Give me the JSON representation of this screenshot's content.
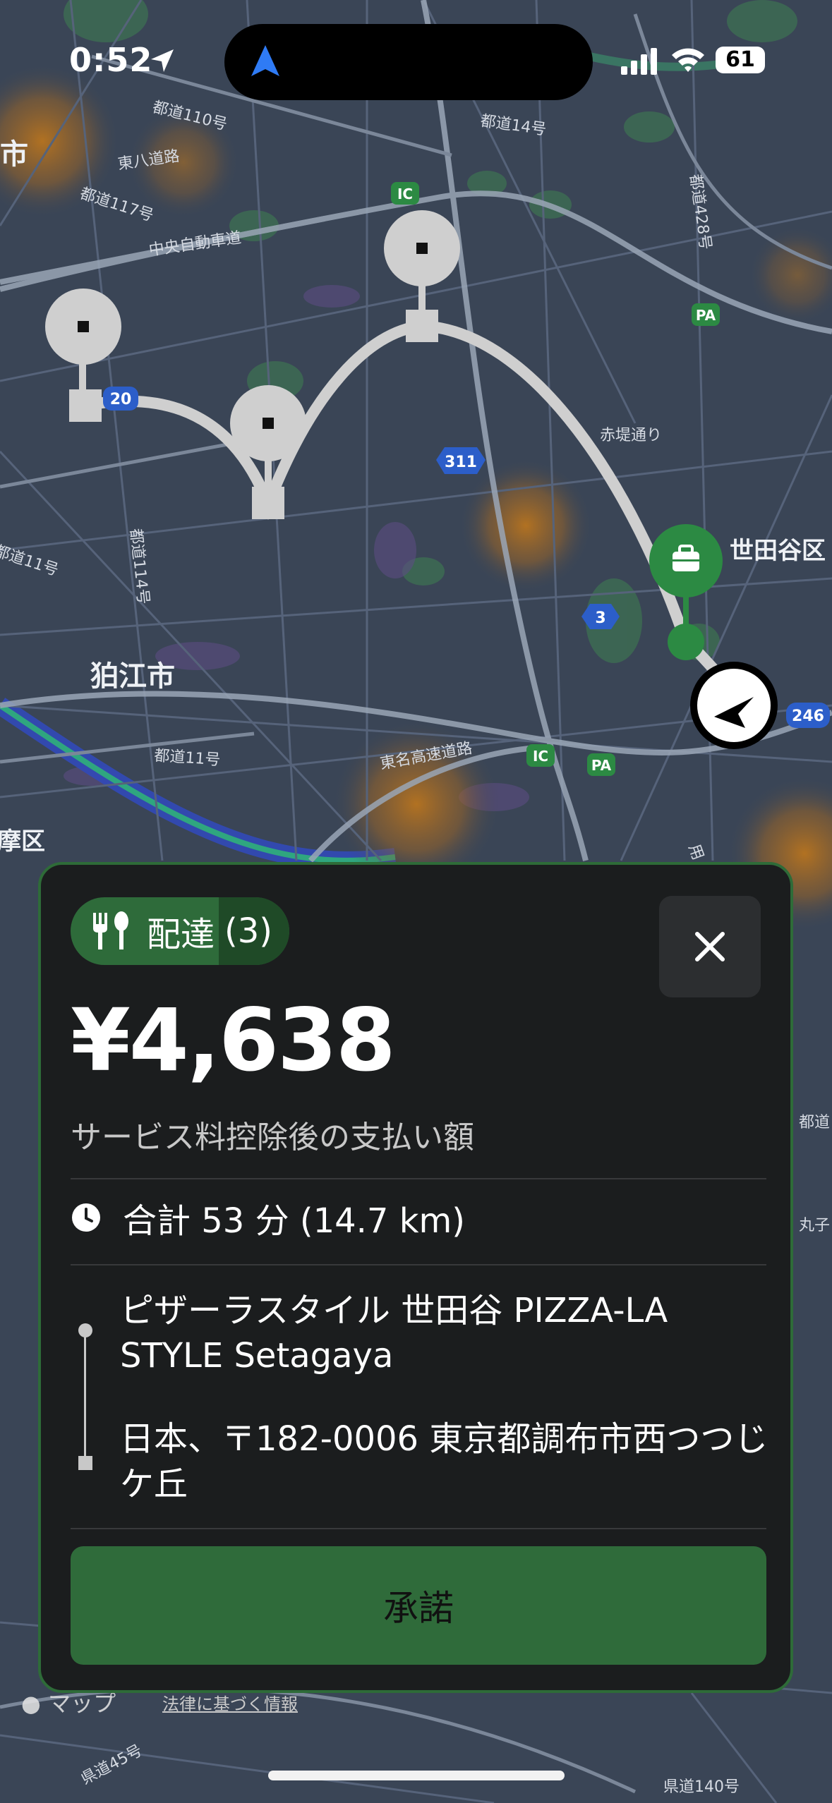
{
  "status_bar": {
    "time": "0:52",
    "battery": "61"
  },
  "map": {
    "labels": {
      "city_left": "市",
      "route110": "都道110号",
      "route14": "都道14号",
      "higashi_hachi": "東八道路",
      "route117": "都道117号",
      "chuo_expressway": "中央自動車道",
      "route428": "都道428号",
      "akatsutsumi": "赤堤通り",
      "setagaya": "世田谷区",
      "komae": "狛江市",
      "route114": "都道114号",
      "route11_left": "都道11号",
      "route11": "都道11号",
      "tomei": "東名高速道路",
      "ward_left": "摩区",
      "route45": "県道45号",
      "route140": "県道140号",
      "pref_road": "都道",
      "toyo": "用",
      "marko": "丸子"
    },
    "shields": {
      "ic1": "IC",
      "ic2": "IC",
      "pa1": "PA",
      "pa2": "PA",
      "r20": "20",
      "r311": "311",
      "r3": "3",
      "r246": "246"
    },
    "attribution": "マップ",
    "legal": "法律に基づく情報"
  },
  "card": {
    "badge_label": "配達",
    "badge_count": "(3)",
    "price": "¥4,638",
    "price_subtitle": "サービス料控除後の支払い額",
    "trip_summary": "合計 53 分 (14.7 km)",
    "pickup_name": "ピザーラスタイル 世田谷 PIZZA-LA STYLE Setagaya",
    "dropoff_address": "日本、〒182-0006 東京都調布市西つつじケ丘",
    "accept_label": "承諾"
  },
  "colors": {
    "map_bg": "#3a4556",
    "card_bg": "#1b1d1e",
    "accent_green": "#2f6b3a",
    "route_gray": "#c8c8c8"
  }
}
